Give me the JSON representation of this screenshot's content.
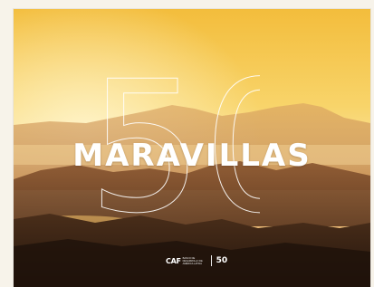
{
  "cover": {
    "title": "MARAVILLAS",
    "big_number": "50",
    "logos": {
      "caf_mark": "CAF",
      "caf_text": "BANCO DE DESARROLLO DE AMÉRICA LATINA",
      "anniversary": "50"
    }
  },
  "colors": {
    "sky_top": "#f6c64a",
    "sky_horizon": "#fbe6a0",
    "mountain_far": "#c98b4a",
    "mountain_near": "#3a2417",
    "text": "#ffffff"
  }
}
